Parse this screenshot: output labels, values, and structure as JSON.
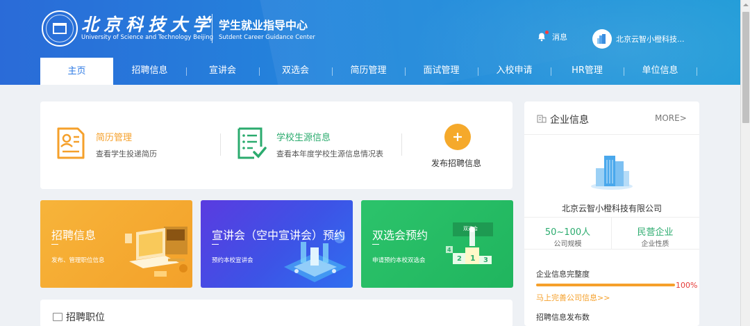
{
  "header": {
    "university_cn": "北京科技大学",
    "university_en": "University of Science and Technology Beijing",
    "center_cn": "学生就业指导中心",
    "center_en": "Sutdent Career Guidance Center",
    "messages_label": "消息",
    "user_name": "北京云智小橙科技..."
  },
  "nav": {
    "items": [
      "主页",
      "招聘信息",
      "宣讲会",
      "双选会",
      "简历管理",
      "面试管理",
      "入校申请",
      "HR管理",
      "单位信息"
    ],
    "active": "主页"
  },
  "quick": {
    "resume": {
      "title": "简历管理",
      "sub": "查看学生投递简历"
    },
    "source": {
      "title": "学校生源信息",
      "sub": "查看本年度学校生源信息情况表"
    },
    "publish": {
      "label": "发布招聘信息"
    }
  },
  "banners": [
    {
      "title": "招聘信息",
      "sub": "发布、管理职位信息"
    },
    {
      "title": "宣讲会（空中宣讲会）预约",
      "sub": "预约本校宣讲会"
    },
    {
      "title": "双选会预约",
      "sub": "申请预约本校双选会",
      "sign": "双选会",
      "podium": [
        "1",
        "2",
        "3",
        "4"
      ]
    }
  ],
  "jobs": {
    "title": "招聘职位"
  },
  "company": {
    "section_title": "企业信息",
    "more": "MORE>",
    "name": "北京云智小橙科技有限公司",
    "scale_value": "50~100人",
    "scale_label": "公司规模",
    "nature_value": "民营企业",
    "nature_label": "企业性质",
    "completeness_label": "企业信息完整度",
    "completeness_value": "100%",
    "completeness_fraction": 1.0,
    "improve_link": "马上完善公司信息>>",
    "post_count_label": "招聘信息发布数"
  },
  "colors": {
    "primary": "#2b78e4",
    "orange": "#f5a02b",
    "green": "#2bab6e",
    "red": "#e53935"
  }
}
